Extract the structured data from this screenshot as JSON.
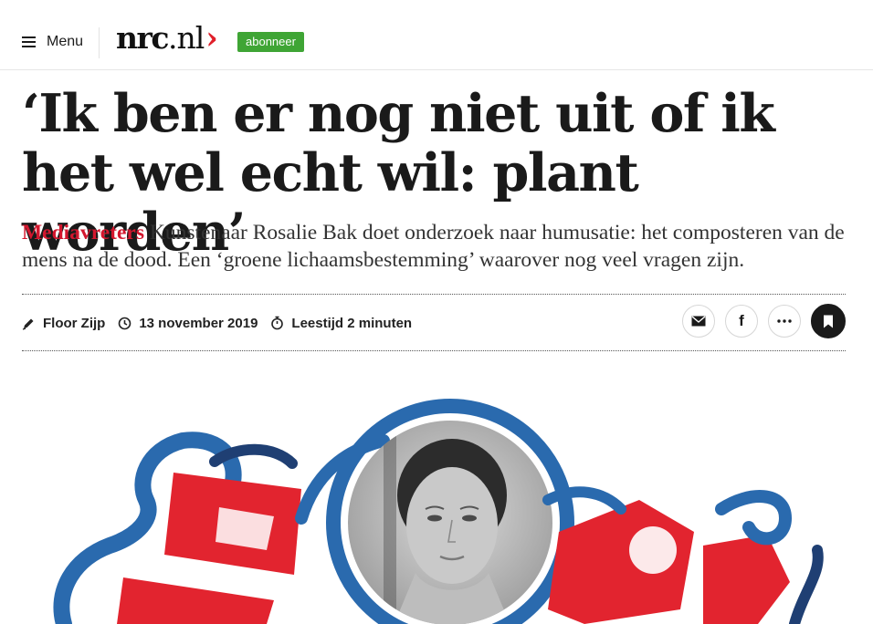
{
  "header": {
    "menu_label": "Menu",
    "logo_main": "nrc",
    "logo_tld": ".nl",
    "logo_chevron": "›",
    "subscribe_label": "abonneer",
    "subscribe_color": "#3fa535"
  },
  "article": {
    "headline": "‘Ik ben er nog niet uit of ik het wel echt wil: plant worden’",
    "kicker": "Mediavreters",
    "intro": " Kunstenaar Rosalie Bak doet onderzoek naar humusatie: het composteren van de mens na de dood. Een ‘groene lichaamsbestemming’ waarover nog veel vragen zijn.",
    "kicker_color": "#d3172e"
  },
  "meta": {
    "author": "Floor Zijp",
    "date": "13 november 2019",
    "reading_time": "Leestijd 2 minuten",
    "author_icon": "pen-icon",
    "date_icon": "clock-icon",
    "reading_icon": "stopwatch-icon"
  },
  "share": {
    "email_icon": "envelope-icon",
    "facebook_icon": "facebook-icon",
    "facebook_glyph": "f",
    "more_icon": "more-dots-icon",
    "bookmark_icon": "bookmark-icon"
  },
  "hero": {
    "colors": {
      "red": "#e2242f",
      "blue": "#2a6aae",
      "navy": "#1f3f73"
    }
  }
}
